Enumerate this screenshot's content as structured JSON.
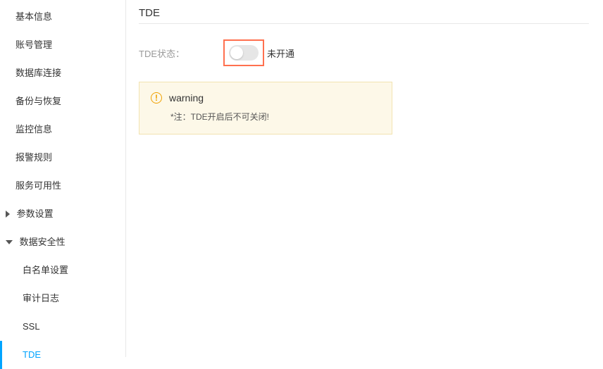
{
  "sidebar": {
    "items": [
      {
        "label": "基本信息"
      },
      {
        "label": "账号管理"
      },
      {
        "label": "数据库连接"
      },
      {
        "label": "备份与恢复"
      },
      {
        "label": "监控信息"
      },
      {
        "label": "报警规则"
      },
      {
        "label": "服务可用性"
      },
      {
        "label": "参数设置"
      },
      {
        "label": "数据安全性"
      },
      {
        "label": "白名单设置"
      },
      {
        "label": "审计日志"
      },
      {
        "label": "SSL"
      },
      {
        "label": "TDE"
      }
    ]
  },
  "main": {
    "title": "TDE",
    "tde_status_label": "TDE状态：",
    "tde_status_value": "未开通",
    "tde_enabled": false,
    "warning": {
      "title": "warning",
      "body": "*注：TDE开启后不可关闭!"
    }
  }
}
